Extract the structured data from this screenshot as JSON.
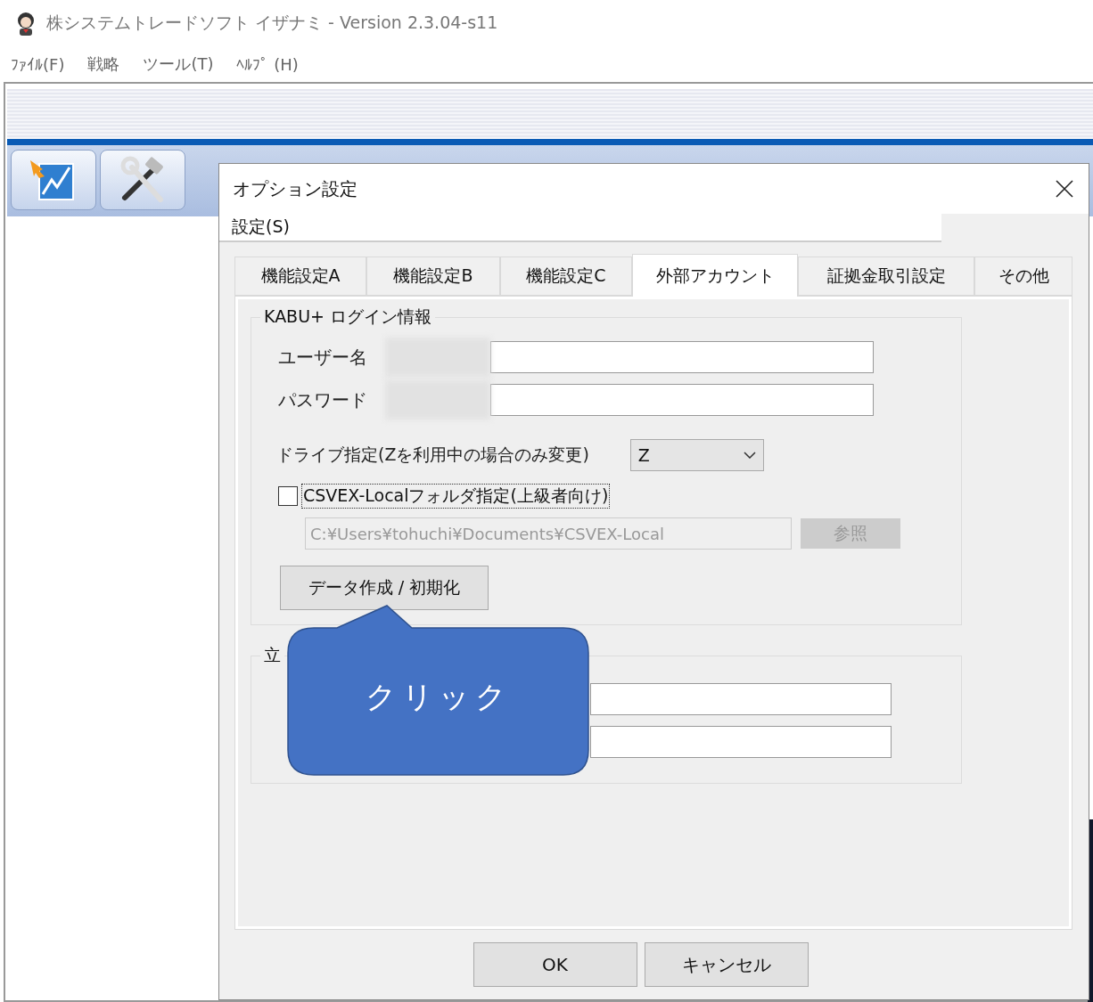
{
  "window": {
    "title": "株システムトレードソフト イザナミ - Version 2.3.04-s11"
  },
  "menu": [
    "ﾌｧｲﾙ(F)",
    "戦略",
    "ツール(T)",
    "ﾍﾙﾌﾟ (H)"
  ],
  "dialog": {
    "title": "オプション設定",
    "menu": [
      "設定(S)"
    ],
    "tabs": [
      {
        "label": "機能設定A",
        "selected": false
      },
      {
        "label": "機能設定B",
        "selected": false
      },
      {
        "label": "機能設定C",
        "selected": false
      },
      {
        "label": "外部アカウント",
        "selected": true
      },
      {
        "label": "証拠金取引設定",
        "selected": false
      },
      {
        "label": "その他",
        "selected": false
      }
    ],
    "kabu_group": {
      "title": "KABU+ ログイン情報",
      "fields": [
        {
          "label": "ユーザー名"
        },
        {
          "label": "パスワード"
        }
      ],
      "drive": {
        "label": "ドライブ指定(Zを利用中の場合のみ変更)",
        "value": "Z"
      },
      "folder_checkbox": {
        "label": "CSVEX-Localフォルダ指定(上級者向け)",
        "checked": false
      },
      "folder": {
        "value": "C:¥Users¥tohuchi¥Documents¥CSVEX-Local",
        "disabled": true
      },
      "browse_button": {
        "label": "参照",
        "disabled": true
      },
      "action_button": "データ作成 / 初期化"
    },
    "second_group": {
      "title": "立",
      "fields": [
        {
          "kind": "text"
        },
        {
          "kind": "text"
        }
      ]
    },
    "buttons": [
      "OK",
      "キャンセル"
    ]
  },
  "callout": {
    "text": "クリック"
  }
}
